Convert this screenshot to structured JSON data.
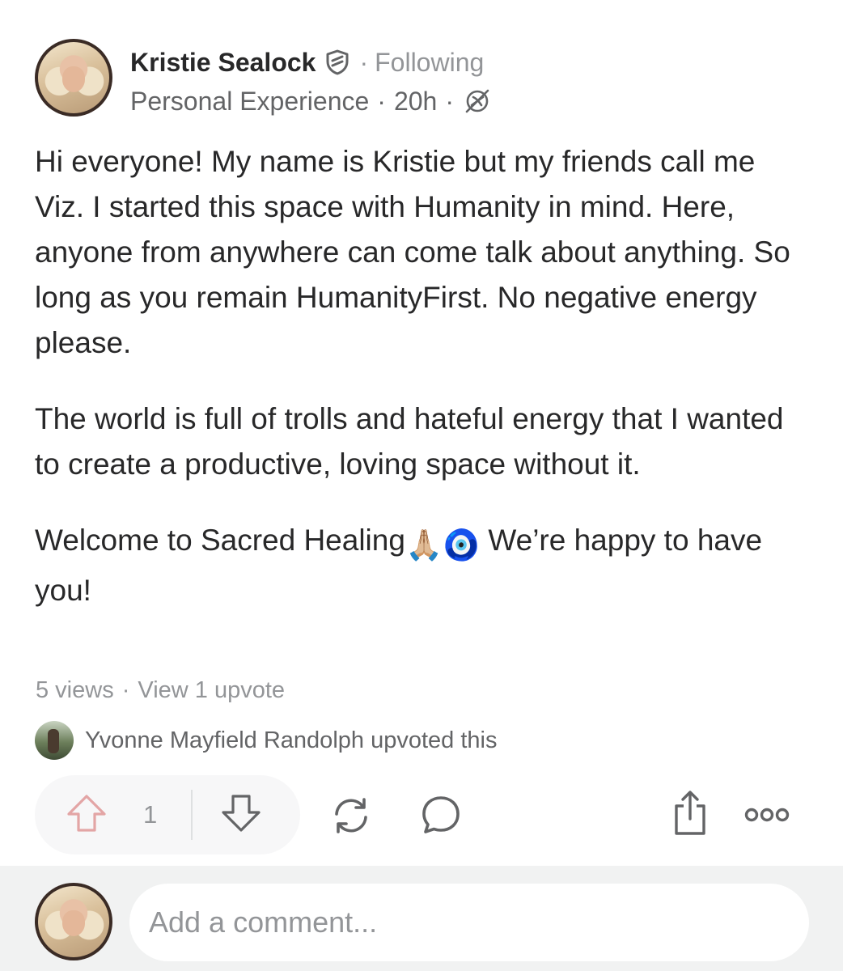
{
  "author": {
    "name": "Kristie Sealock",
    "follow_status": "Following",
    "separator": "·",
    "credential": "Personal Experience",
    "time": "20h"
  },
  "post": {
    "paragraphs": [
      "Hi everyone! My name is Kristie but my friends call me Viz. I started this space with Humanity in mind. Here, anyone from anywhere can come talk about anything. So long as you remain HumanityFirst. No negative energy please.",
      "The world is full of trolls and hateful energy that I wanted to create a productive, loving space without it."
    ],
    "final_paragraph": {
      "before_emoji": "Welcome to Sacred Healing",
      "emojis": "🙏🏼🧿",
      "after_emoji": " We’re happy to have you!"
    }
  },
  "stats": {
    "views": "5 views",
    "separator": "·",
    "upvotes_link": "View 1 upvote"
  },
  "upvoter": {
    "text": "Yvonne Mayfield Randolph upvoted this"
  },
  "actions": {
    "upvote_count": "1"
  },
  "comment": {
    "placeholder": "Add a comment..."
  },
  "colors": {
    "text_primary": "#282829",
    "text_secondary": "#636466",
    "text_muted": "#939598",
    "upvote_icon": "#e3a5a5",
    "icon_gray": "#636466",
    "pill_bg": "#f7f7f8",
    "comment_bar_bg": "#f1f2f2"
  }
}
